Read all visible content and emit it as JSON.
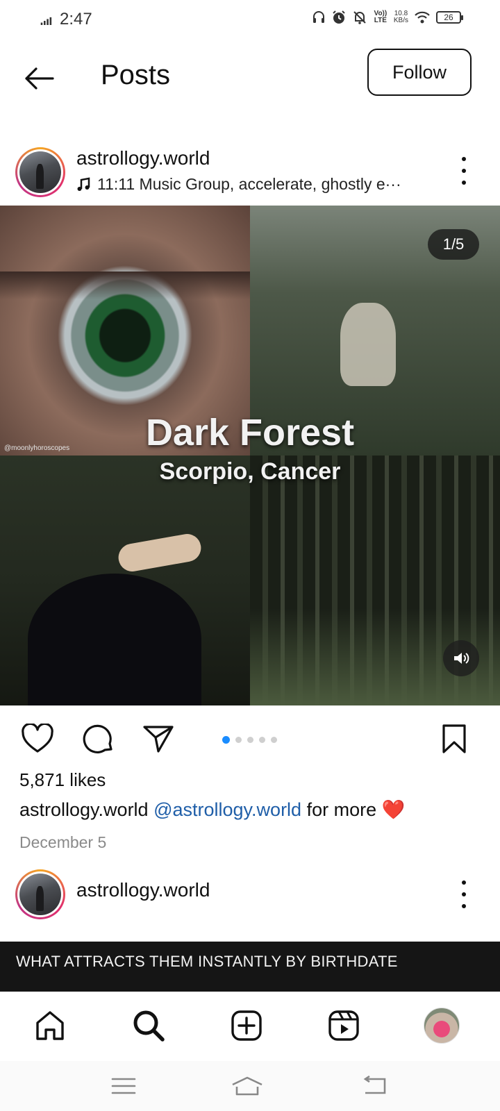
{
  "status_bar": {
    "time": "2:47",
    "net_speed_value": "10.8",
    "net_speed_unit": "KB/s",
    "volte_label": "Vo)) LTE",
    "battery": "26"
  },
  "header": {
    "title": "Posts",
    "follow_label": "Follow"
  },
  "post": {
    "username": "astrollogy.world",
    "music": "11:11 Music Group, accelerate, ghostly e···",
    "media": {
      "counter": "1/5",
      "watermark": "@moonlyhoroscopes",
      "title": "Dark Forest",
      "subtitle": "Scorpio, Cancer",
      "current_slide": 1,
      "total_slides": 5
    },
    "likes": "5,871 likes",
    "caption_user": "astrollogy.world",
    "caption_mention": "@astrollogy.world",
    "caption_text": " for more ❤️",
    "date": "December 5"
  },
  "post2": {
    "username": "astrollogy.world",
    "banner": "WHAT ATTRACTS THEM INSTANTLY BY BIRTHDATE"
  },
  "colors": {
    "accent": "#1a8cff",
    "mention": "#1f5ea8",
    "story_ring": [
      "#f5a623",
      "#e1306c",
      "#c13584"
    ]
  },
  "icons": {
    "back": "arrow-left-icon",
    "music": "music-note-icon",
    "more": "more-vertical-icon",
    "like": "heart-icon",
    "comment": "comment-icon",
    "share": "send-icon",
    "save": "bookmark-icon",
    "sound": "speaker-icon",
    "nav": [
      "home-icon",
      "search-icon",
      "create-icon",
      "reels-icon",
      "profile-avatar"
    ]
  }
}
